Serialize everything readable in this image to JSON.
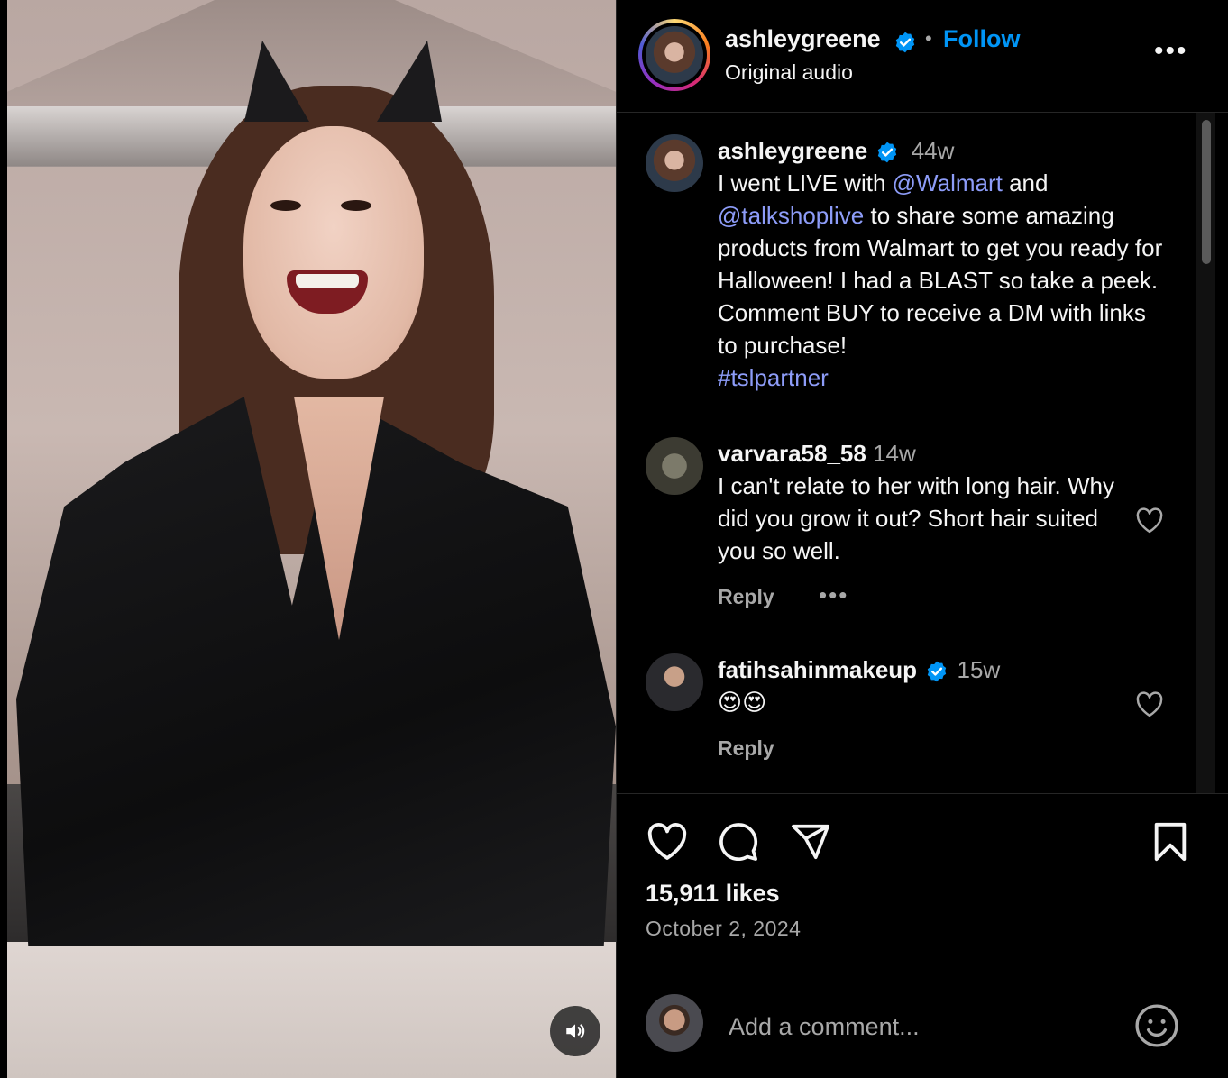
{
  "post": {
    "username": "ashleygreene",
    "dot": "•",
    "follow_label": "Follow",
    "audio": "Original audio",
    "more_label": "•••"
  },
  "comments": [
    {
      "username": "ashleygreene",
      "time": "44w",
      "verified": true,
      "text_parts": {
        "p1": "I went LIVE with ",
        "m1": "@Walmart",
        "p2": " and ",
        "m2": "@talkshoplive",
        "p3": " to share some amazing products from Walmart to get you ready for Halloween! I had a BLAST so take a peek. Comment BUY to receive a DM with links to purchase! ",
        "tag": "#tslpartner"
      }
    },
    {
      "username": "varvara58_58",
      "time": "14w",
      "verified": false,
      "text": "I can't relate to her with long hair. Why did you grow it out? Short hair suited you so well.",
      "reply_label": "Reply",
      "more_label": "•••"
    },
    {
      "username": "fatihsahinmakeup",
      "time": "15w",
      "verified": true,
      "text": "😍😍",
      "reply_label": "Reply"
    }
  ],
  "footer": {
    "likes": "15,911 likes",
    "date": "October 2, 2024",
    "comment_placeholder": "Add a comment..."
  },
  "colors": {
    "background": "#000000",
    "link": "#8d9cf8",
    "follow": "#0095f6",
    "verified": "#0095f6",
    "secondary_text": "#a8a8a8"
  },
  "icons": {
    "mute": "speaker-icon",
    "like": "heart-icon",
    "comment": "comment-bubble-icon",
    "share": "paper-plane-icon",
    "save": "bookmark-icon",
    "emoji": "smiley-icon"
  }
}
